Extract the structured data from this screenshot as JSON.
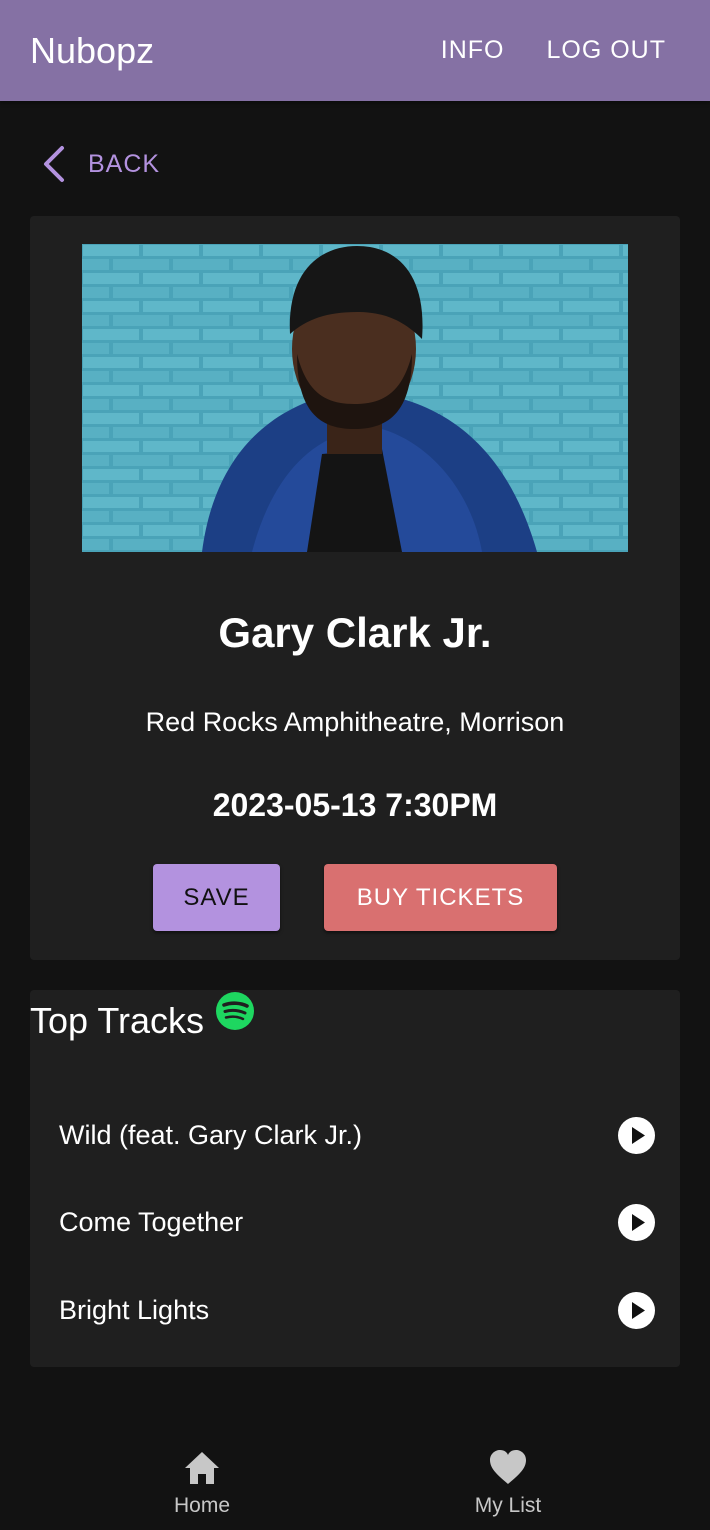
{
  "appbar": {
    "title": "Nubopz",
    "info_label": "INFO",
    "logout_label": "LOG OUT",
    "color": "#8571a4"
  },
  "back": {
    "label": "BACK",
    "icon": "chevron-left-icon"
  },
  "event": {
    "artist": "Gary Clark Jr.",
    "venue": "Red Rocks Amphitheatre, Morrison",
    "datetime": "2023-05-13 7:30PM",
    "save_label": "SAVE",
    "buy_label": "BUY TICKETS",
    "save_color": "#b392df",
    "buy_color": "#d97070"
  },
  "top_tracks": {
    "title": "Top Tracks",
    "icon": "spotify-icon",
    "tracks": [
      {
        "title": "Wild (feat. Gary Clark Jr.)"
      },
      {
        "title": "Come Together"
      },
      {
        "title": "Bright Lights"
      }
    ]
  },
  "bottom_nav": {
    "items": [
      {
        "label": "Home",
        "icon": "home-icon"
      },
      {
        "label": "My List",
        "icon": "heart-icon"
      }
    ]
  }
}
